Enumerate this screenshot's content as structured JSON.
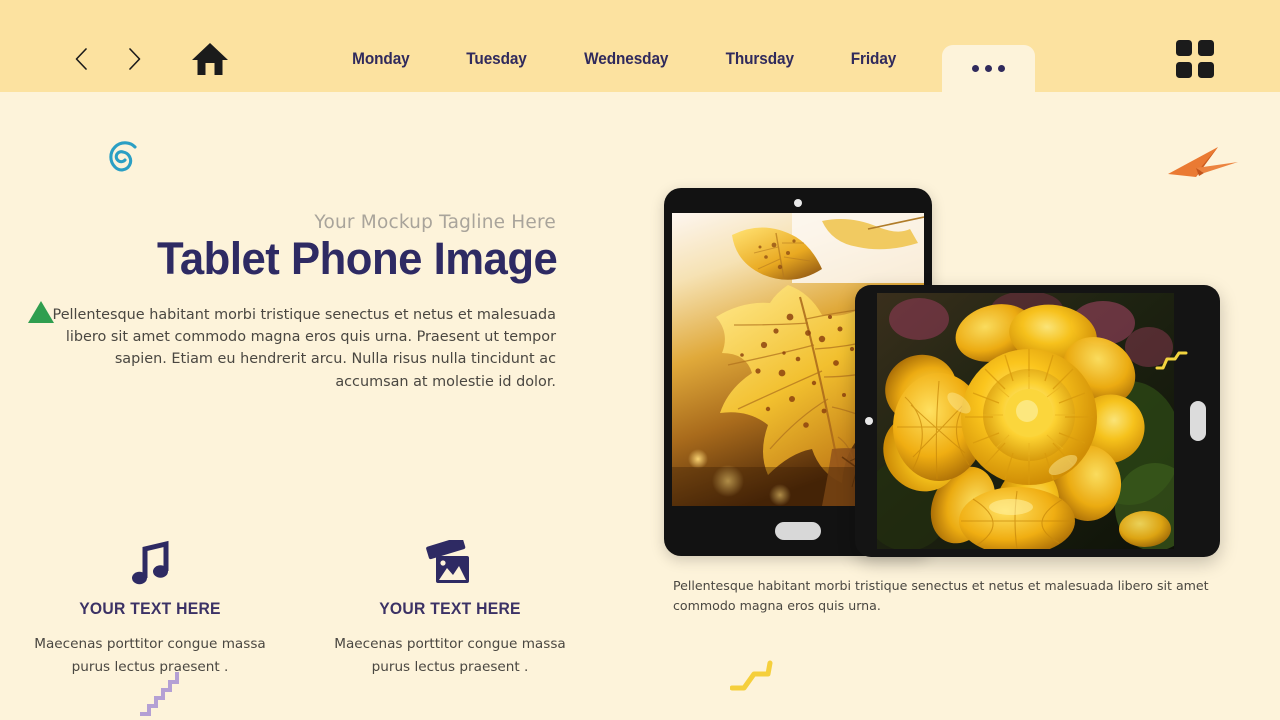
{
  "nav": {
    "back_icon": "chevron-left-icon",
    "forward_icon": "chevron-right-icon",
    "home_icon": "home-icon",
    "grid_icon": "grid-2x2-icon",
    "items": [
      {
        "label": "Monday"
      },
      {
        "label": "Tuesday"
      },
      {
        "label": "Wednesday"
      },
      {
        "label": "Thursday"
      },
      {
        "label": "Friday"
      }
    ],
    "more_label": "•••",
    "active_tab": "more",
    "bar_color": "#fce2a0",
    "link_color": "#302a5c"
  },
  "hero": {
    "tagline": "Your Mockup Tagline Here",
    "headline": "Tablet Phone Image",
    "body": "Pellentesque habitant morbi  tristique senectus et netus et malesuada libero sit amet commodo  magna eros quis urna. Praesent ut tempor  sapien. Etiam eu hendrerit  arcu. Nulla risus nulla tincidunt  ac accumsan at molestie id dolor.",
    "headline_color": "#2e2a63",
    "tagline_color": "#a9a49b"
  },
  "features": [
    {
      "icon": "music-note-icon",
      "title": "YOUR TEXT HERE",
      "desc": "Maecenas porttitor  congue massa purus lectus praesent ."
    },
    {
      "icon": "photo-image-icon",
      "title": "YOUR TEXT HERE",
      "desc": "Maecenas porttitor  congue massa purus lectus praesent ."
    }
  ],
  "mockup": {
    "portrait": {
      "name": "tablet-portrait",
      "image_subject": "autumn-yellow-maple-leaves",
      "camera": "front-camera-dot",
      "home": "home-button-pill"
    },
    "landscape": {
      "name": "tablet-landscape",
      "image_subject": "yellow-chrysanthemum-flowers",
      "camera": "front-camera-dot",
      "home": "home-button-pill"
    },
    "caption": "Pellentesque habitant morbi tristique senectus et  netus et malesuada libero sit amet commodo magna eros quis urna."
  },
  "decorations": [
    {
      "name": "spiral-decoration",
      "color": "#2b9fc4"
    },
    {
      "name": "paper-plane-decoration",
      "color": "#e8702a"
    },
    {
      "name": "triangle-decoration",
      "color": "#2f9e4f"
    },
    {
      "name": "staircase-zigzag-decoration",
      "color": "#b4a0d4"
    },
    {
      "name": "yellow-zigzag-decoration",
      "color": "#f5cf3c"
    },
    {
      "name": "small-yellow-zigzag-decoration",
      "color": "#f2d43f"
    }
  ],
  "theme": {
    "page_background": "#fdf3da",
    "accent_navy": "#2e2a63"
  }
}
